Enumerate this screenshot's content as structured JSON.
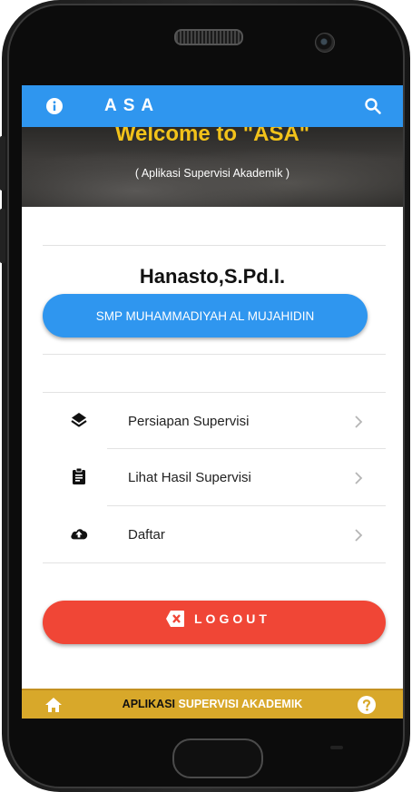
{
  "app_bar": {
    "title": "ASA",
    "left_icon": "info-icon",
    "right_icon": "search-icon",
    "color": "#2f96ef"
  },
  "banner": {
    "welcome": "Welcome to \"ASA\"",
    "subtitle": "( Aplikasi Supervisi Akademik )"
  },
  "profile": {
    "name": "Hanasto,S.Pd.I.",
    "school": "SMP MUHAMMADIYAH AL MUJAHIDIN"
  },
  "menu": [
    {
      "label": "Persiapan Supervisi",
      "icon": "layers-icon"
    },
    {
      "label": "Lihat Hasil Supervisi",
      "icon": "clipboard-icon"
    },
    {
      "label": "Daftar",
      "icon": "cloud-upload-icon"
    }
  ],
  "logout": {
    "label": "LOGOUT",
    "icon": "close-box-icon",
    "color": "#f04636"
  },
  "bottom_bar": {
    "text_a": "APLIKASI ",
    "text_b": "SUPERVISI AKADEMIK",
    "left_icon": "home-icon",
    "right_icon": "help-icon",
    "color": "#d8a82a"
  }
}
